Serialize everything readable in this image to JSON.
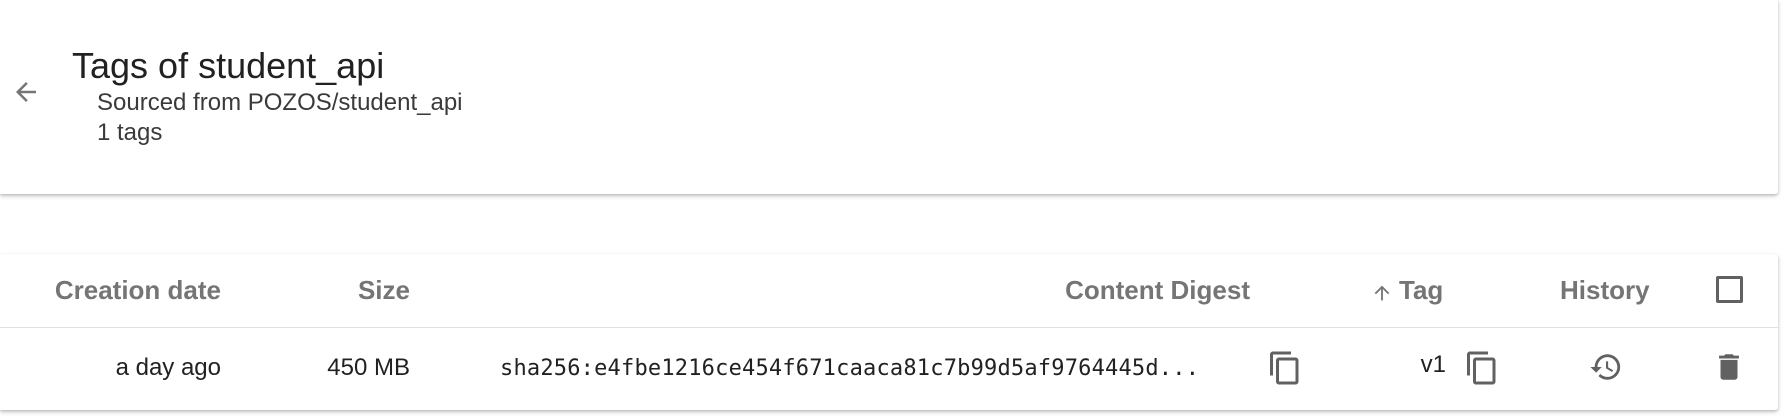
{
  "header": {
    "title": "Tags of student_api",
    "subtitle": "Sourced from POZOS/student_api",
    "tags_count": "1 tags",
    "back_icon": "arrow-back-icon"
  },
  "table": {
    "columns": {
      "creation_date": "Creation date",
      "size": "Size",
      "content_digest": "Content Digest",
      "tag": "Tag",
      "history": "History"
    },
    "sort": {
      "column": "tag",
      "direction": "ascending",
      "icon": "arrow-up-icon"
    },
    "select_all_checked": false,
    "rows": [
      {
        "creation_date": "a day ago",
        "size": "450 MB",
        "content_digest": "sha256:e4fbe1216ce454f671caaca81c7b99d5af9764445d...",
        "tag": "v1",
        "icons": {
          "copy_digest": "copy-icon",
          "copy_tag": "copy-icon",
          "history": "history-icon",
          "delete": "delete-icon"
        }
      }
    ]
  },
  "colors": {
    "text_primary": "#212121",
    "header_text": "#757575",
    "icon": "#616161",
    "divider": "#e0e0e0"
  }
}
